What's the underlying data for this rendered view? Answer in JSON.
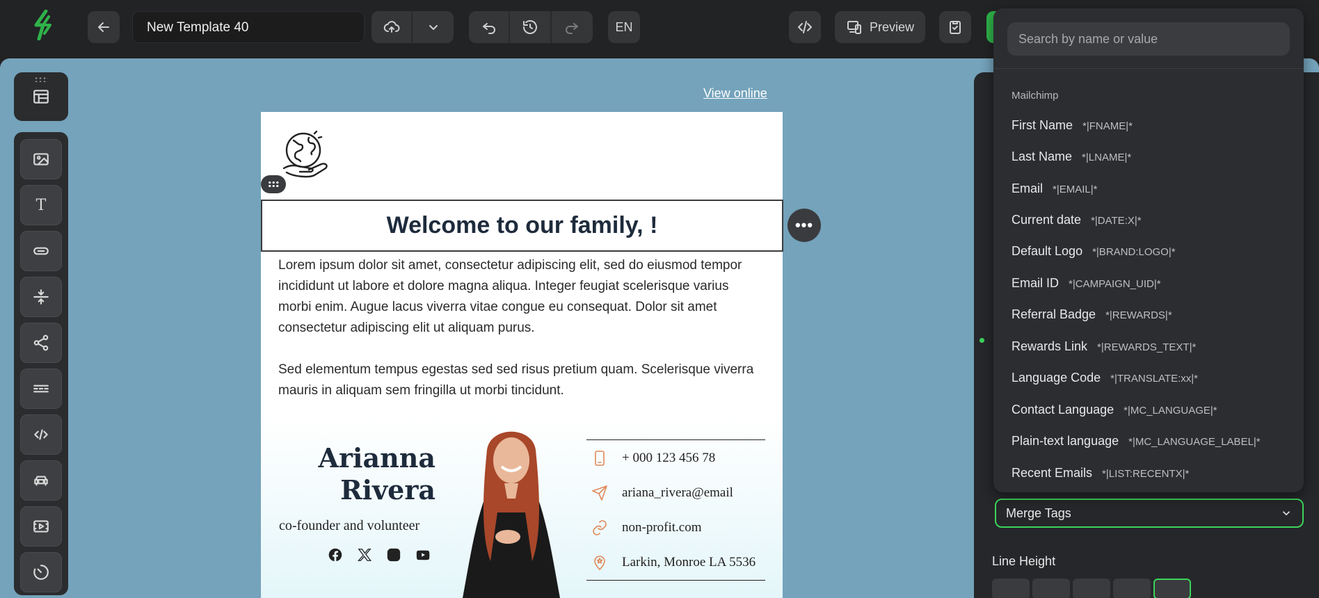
{
  "topbar": {
    "template_name": "New Template 40",
    "language": "EN",
    "preview_label": "Preview"
  },
  "email": {
    "view_online": "View online",
    "heading": "Welcome to our family, !",
    "paragraph1": "Lorem ipsum dolor sit amet, consectetur adipiscing elit, sed do eiusmod tempor incididunt ut labore et dolore magna aliqua. Integer feugiat scelerisque varius morbi enim. Augue lacus viverra vitae congue eu consequat. Dolor sit amet consectetur adipiscing elit ut aliquam purus.",
    "paragraph2": "Sed elementum tempus egestas sed sed risus pretium quam. Scelerisque viverra mauris in aliquam sem fringilla ut morbi tincidunt.",
    "signature": {
      "first_name": "Arianna",
      "last_name": "Rivera",
      "role": "co-founder and volunteer",
      "phone": "+ 000 123 456 78",
      "email": "ariana_rivera@email",
      "website": "non-profit.com",
      "address": "Larkin, Monroe LA 5536"
    }
  },
  "dropdown": {
    "search_placeholder": "Search by name or value",
    "group": "Mailchimp",
    "items": [
      {
        "name": "First Name",
        "value": "*|FNAME|*"
      },
      {
        "name": "Last Name",
        "value": "*|LNAME|*"
      },
      {
        "name": "Email",
        "value": "*|EMAIL|*"
      },
      {
        "name": "Current date",
        "value": "*|DATE:X|*"
      },
      {
        "name": "Default Logo",
        "value": "*|BRAND:LOGO|*"
      },
      {
        "name": "Email ID",
        "value": "*|CAMPAIGN_UID|*"
      },
      {
        "name": "Referral Badge",
        "value": "*|REWARDS|*"
      },
      {
        "name": "Rewards Link",
        "value": "*|REWARDS_TEXT|*"
      },
      {
        "name": "Language Code",
        "value": "*|TRANSLATE:xx|*"
      },
      {
        "name": "Contact Language",
        "value": "*|MC_LANGUAGE|*"
      },
      {
        "name": "Plain-text language",
        "value": "*|MC_LANGUAGE_LABEL|*"
      },
      {
        "name": "Recent Emails",
        "value": "*|LIST:RECENTX|*"
      }
    ]
  },
  "panel": {
    "merge_tags_label": "Merge Tags",
    "line_height_label": "Line Height"
  },
  "colors": {
    "canvas_bg": "#74a3bb",
    "accent_green": "#3cd45a",
    "heading_text": "#1e2b3c",
    "icon_accent": "#e08a5a"
  },
  "icons": [
    "back-arrow-icon",
    "upload-cloud-icon",
    "chevron-down-icon",
    "undo-icon",
    "history-icon",
    "redo-icon",
    "code-icon",
    "devices-icon",
    "clipboard-check-icon",
    "layout-icon",
    "image-icon",
    "text-icon",
    "button-icon",
    "spacer-icon",
    "share-icon",
    "divider-icon",
    "html-icon",
    "menu-icon",
    "video-icon",
    "timer-icon"
  ]
}
